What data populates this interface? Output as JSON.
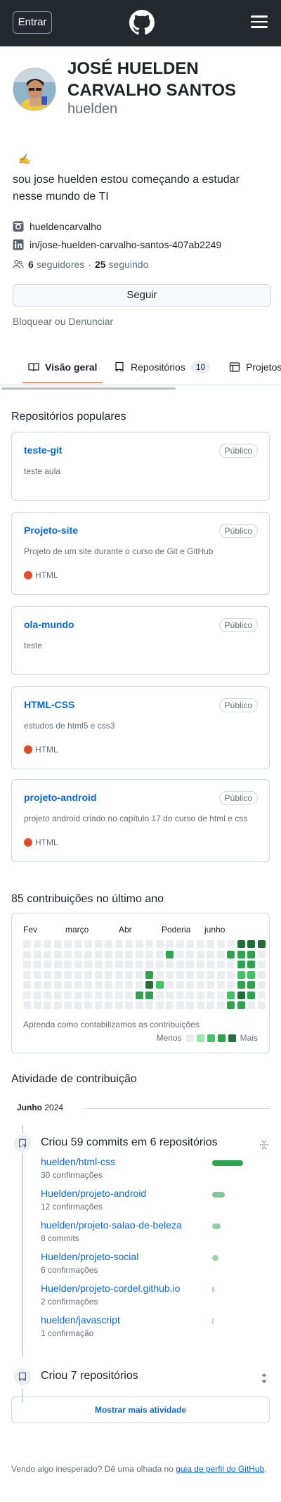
{
  "header": {
    "signin_label": "Entrar",
    "logo_icon": "github-mark-icon",
    "menu_icon": "hamburger-menu-icon"
  },
  "profile": {
    "full_name": "JOSÉ HUELDEN CARVALHO SANTOS",
    "login": "huelden",
    "status_emoji": "✍️",
    "bio": "sou jose huelden estou começando a estudar nesse mundo de TI",
    "instagram": "hueldencarvalho",
    "linkedin": "in/jose-huelden-carvalho-santos-407ab2249",
    "followers_count": "6",
    "followers_label": "seguidores",
    "separator": "·",
    "following_count": "25",
    "following_label": "seguindo",
    "follow_label": "Seguir",
    "block_label": "Bloquear ou Denunciar"
  },
  "tabs": [
    {
      "label": "Visão geral",
      "icon": "book-open-icon"
    },
    {
      "label": "Repositórios",
      "icon": "repo-icon",
      "count": "10"
    },
    {
      "label": "Projetos",
      "icon": "table-icon"
    }
  ],
  "popular": {
    "title": "Repositórios populares",
    "repos": [
      {
        "name": "teste-git",
        "visibility": "Público",
        "description": "teste aula",
        "language": ""
      },
      {
        "name": "Projeto-site",
        "visibility": "Público",
        "description": "Projeto de um site durante o curso de Git e GitHub",
        "language": "HTML"
      },
      {
        "name": "ola-mundo",
        "visibility": "Público",
        "description": "teste",
        "language": ""
      },
      {
        "name": "HTML-CSS",
        "visibility": "Público",
        "description": "estudos de html5 e css3",
        "language": "HTML"
      },
      {
        "name": "projeto-android",
        "visibility": "Público",
        "description": "projeto android criado no capítulo 17 do curso de html e css",
        "language": "HTML"
      }
    ],
    "language_color": "#e34c26"
  },
  "contributions": {
    "title": "85 contribuições no último ano",
    "months": [
      "Fev",
      "março",
      "Abr",
      "Poderia",
      "junho"
    ],
    "note": "Aprenda como contabilizamos as contribuições",
    "legend_less": "Menos",
    "legend_more": "Mais",
    "colors": [
      "#ebedf0",
      "#9be9a8",
      "#40c463",
      "#30a14e",
      "#216e39"
    ]
  },
  "activity": {
    "title": "Atividade de contribuição",
    "month_bold": "Junho",
    "year": "2024",
    "commits_title": "Criou 59 commits em 6 repositórios",
    "commits": [
      {
        "repo": "huelden/html-css",
        "detail": "30 confirmações",
        "share": 1.0
      },
      {
        "repo": "Huelden/projeto-android",
        "detail": "12 confirmações",
        "share": 0.4
      },
      {
        "repo": "huelden/projeto-salao-de-beleza",
        "detail": "8 commits",
        "share": 0.27
      },
      {
        "repo": "Huelden/projeto-social",
        "detail": "6 confirmações",
        "share": 0.2
      },
      {
        "repo": "Huelden/projeto-cordel.github.io",
        "detail": "2 confirmações",
        "share": 0.07
      },
      {
        "repo": "huelden/javascript",
        "detail": "1 confirmação",
        "share": 0.03
      }
    ],
    "repos_title": "Criou 7 repositórios",
    "more_label": "Mostrar mais atividade",
    "footer_text": "Vendo algo inesperado? Dê uma olhada no",
    "footer_link": "guia de perfil do GitHub",
    "footer_end": "."
  }
}
